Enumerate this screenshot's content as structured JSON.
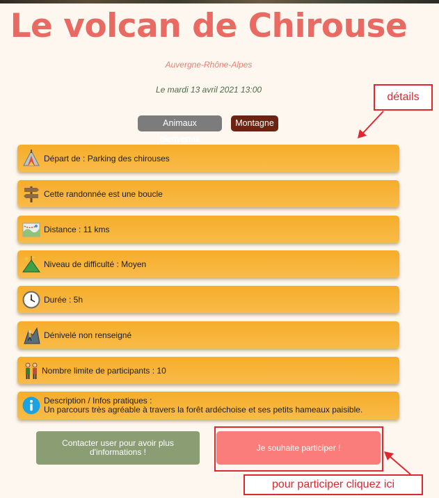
{
  "header": {
    "title": "Le volcan de Chirouse",
    "region": "Auvergne-Rhône-Alpes",
    "date": "Le mardi 13 avril 2021 13:00"
  },
  "tags": [
    {
      "label": "Animaux bienvenus"
    },
    {
      "label": "Montagne"
    }
  ],
  "details": {
    "departure": {
      "label": "Départ de : Parking des chirouses",
      "icon": "campfire-tent-icon"
    },
    "loop": {
      "label": "Cette randonnée est une boucle",
      "icon": "signpost-icon"
    },
    "distance": {
      "label": "Distance : 11 kms",
      "icon": "map-icon"
    },
    "difficulty": {
      "label": "Niveau de difficulté : Moyen",
      "icon": "mountain-summit-icon"
    },
    "duration": {
      "label": "Durée : 5h",
      "icon": "clock-icon"
    },
    "elevation": {
      "label": "Dénivelé non renseigné",
      "icon": "climber-icon"
    },
    "participants": {
      "label": "Nombre limite de participants : 10",
      "icon": "hikers-icon"
    },
    "description": {
      "title": "Description / Infos pratiques :",
      "text": "Un parcours très agréable à travers la forêt ardéchoise et ses petits hameaux paisible.",
      "icon": "info-icon"
    }
  },
  "actions": {
    "contact_label": "Contacter user pour avoir plus d'informations !",
    "participate_label": "Je souhaite participer !"
  },
  "annotations": {
    "details_label": "détails",
    "participate_hint": "pour participer cliquez ici"
  },
  "colors": {
    "title": "#e96a62",
    "row_background": "#f6ad2a",
    "contact_button": "#8a9d73",
    "participate_button": "#fb7d7b",
    "annotation_red": "#e0262e"
  }
}
